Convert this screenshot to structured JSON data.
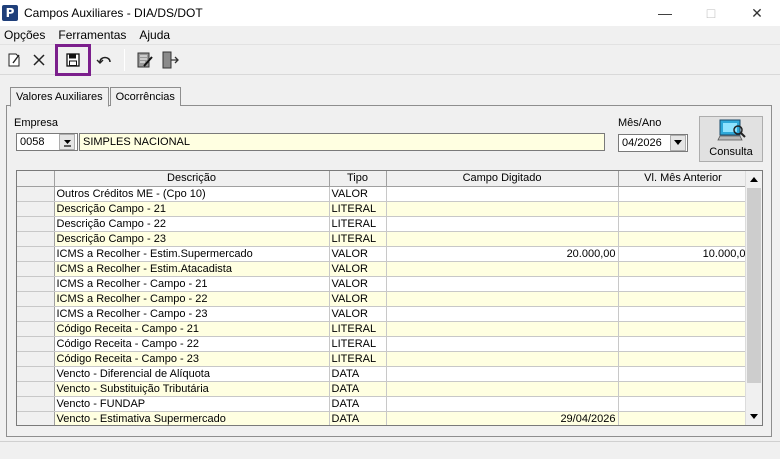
{
  "window": {
    "title": "Campos Auxiliares - DIA/DS/DOT",
    "app_icon_letter": "P"
  },
  "menu": [
    "Opções",
    "Ferramentas",
    "Ajuda"
  ],
  "tabs": [
    "Valores Auxiliares",
    "Ocorrências"
  ],
  "form": {
    "empresa_label": "Empresa",
    "empresa_code": "0058",
    "empresa_name": "SIMPLES NACIONAL",
    "mes_ano_label": "Mês/Ano",
    "mes_ano_value": "04/2026",
    "consulta_label": "Consulta"
  },
  "grid": {
    "headers": [
      "Descrição",
      "Tipo",
      "Campo Digitado",
      "Vl. Mês Anterior"
    ],
    "rows": [
      [
        "Outros Créditos ME - (Cpo 10)",
        "VALOR",
        "",
        ""
      ],
      [
        "Descrição Campo - 21",
        "LITERAL",
        "",
        ""
      ],
      [
        "Descrição Campo - 22",
        "LITERAL",
        "",
        ""
      ],
      [
        "Descrição Campo - 23",
        "LITERAL",
        "",
        ""
      ],
      [
        "ICMS a Recolher - Estim.Supermercado",
        "VALOR",
        "20.000,00",
        "10.000,0"
      ],
      [
        "ICMS a Recolher - Estim.Atacadista",
        "VALOR",
        "",
        ""
      ],
      [
        "ICMS a Recolher - Campo - 21",
        "VALOR",
        "",
        ""
      ],
      [
        "ICMS a Recolher - Campo - 22",
        "VALOR",
        "",
        ""
      ],
      [
        "ICMS a Recolher - Campo - 23",
        "VALOR",
        "",
        ""
      ],
      [
        "Código Receita  - Campo - 21",
        "LITERAL",
        "",
        ""
      ],
      [
        "Código Receita  - Campo - 22",
        "LITERAL",
        "",
        ""
      ],
      [
        "Código Receita  - Campo - 23",
        "LITERAL",
        "",
        ""
      ],
      [
        "Vencto - Diferencial de Alíquota",
        "DATA",
        "",
        ""
      ],
      [
        "Vencto - Substituição Tributária",
        "DATA",
        "",
        ""
      ],
      [
        "Vencto - FUNDAP",
        "DATA",
        "",
        ""
      ],
      [
        "Vencto - Estimativa Supermercado",
        "DATA",
        "29/04/2026",
        ""
      ]
    ]
  }
}
